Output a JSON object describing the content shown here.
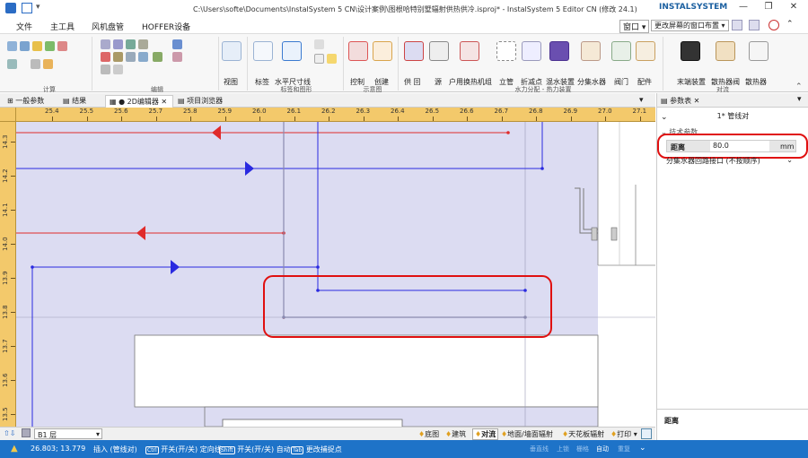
{
  "window": {
    "title": "C:\\Users\\softe\\Documents\\InstalSystem 5 CN\\设计案例\\图根哈特别墅辐射供热供冷.isproj* - InstalSystem 5 Editor CN (修改 24.1)",
    "brand": "INSTALSYSTEM"
  },
  "menu": {
    "items": [
      "文件",
      "主工具",
      "风机盘管",
      "HOFFER设备"
    ],
    "window_btn": "窗口",
    "layout_btn": "更改屏幕的窗口布置"
  },
  "ribbon": {
    "groups": [
      "计算",
      "编辑",
      "标签和图形",
      "示意图",
      "水力分配 - 热力装置",
      "对流"
    ],
    "buttons": [
      "视图",
      "标签",
      "水平尺寸线",
      "控制",
      "创建",
      "供 回",
      "源",
      "户用换热机组",
      "立管",
      "折减点",
      "混水装置",
      "分集水器",
      "阀门",
      "配件",
      "末端装置",
      "散热器阀",
      "散热器"
    ]
  },
  "tabs": {
    "items": [
      "一般参数",
      "结果",
      "2D编辑器",
      "项目浏览器"
    ]
  },
  "ruler": {
    "top": [
      "25.4",
      "25.5",
      "25.6",
      "25.7",
      "25.8",
      "25.9",
      "26.0",
      "26.1",
      "26.2",
      "26.3",
      "26.4",
      "26.5",
      "26.6",
      "26.7",
      "26.8",
      "26.9",
      "27.0",
      "27.1"
    ],
    "left": [
      "14.3",
      "14.2",
      "14.1",
      "14.0",
      "13.9",
      "13.8",
      "13.7",
      "13.6",
      "13.5"
    ]
  },
  "colors": {
    "room": "#dcdcf2",
    "supply": "#e02b2b",
    "return": "#2a2ae0",
    "pipe_gray": "#8a8ab0",
    "highlight": "#e01010",
    "status": "#1e73c8"
  },
  "bottombar": {
    "floor_label": "B1 层",
    "layers": [
      "底图",
      "建筑",
      "对流",
      "地面/墙面辐射",
      "天花板辐射",
      "打印"
    ]
  },
  "status": {
    "coords": "26.803; 13.779",
    "mode": "插入 (管线对)",
    "ctrl_label": "开关(开/关) 定向线",
    "shift_label": "开关(开/关) 自动",
    "tab_label": "更改捕捉点",
    "right_items": [
      "垂直线",
      "上锁",
      "栅格",
      "自动",
      "重复"
    ]
  },
  "panel": {
    "title": "参数表",
    "section_header": "1* 管线对",
    "subheader": "技术参数",
    "field_label": "距离",
    "field_value": "80.0",
    "field_unit": "mm",
    "select_value": "分集水器回路接口 (不按顺序)",
    "footer_label": "距离"
  }
}
